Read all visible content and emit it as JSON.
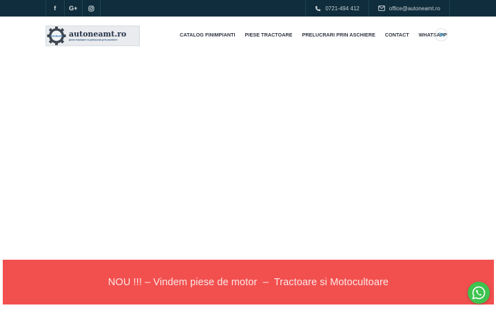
{
  "topbar": {
    "social": [
      {
        "icon": "facebook-icon",
        "glyph": "f"
      },
      {
        "icon": "google-plus-icon",
        "glyph": "G+"
      },
      {
        "icon": "instagram-icon",
        "glyph": ""
      }
    ],
    "phone": "0721-494 412",
    "email": "office@autoneamt.ro"
  },
  "header": {
    "logo_name": "autoneamt.ro",
    "logo_subtitle": "piese tractoare si prelucrari prin aschiere",
    "logo_gear_text": "AutoNeamt",
    "nav": [
      "CATALOG FINIMPIANTI",
      "PIESE TRACTOARE",
      "PRELUCRARI PRIN ASCHIERE",
      "CONTACT",
      "WHATSAPP"
    ]
  },
  "banner": {
    "text": "NOU !!! – Vindem piese de motor  –  Tractoare si Motocultoare"
  },
  "colors": {
    "topbar": "#0f2d3c",
    "banner": "#f2504f",
    "whatsapp": "#3ec34f"
  }
}
